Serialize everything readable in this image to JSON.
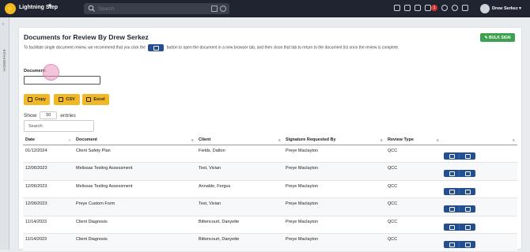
{
  "header": {
    "brand": "Lightning Step",
    "logo_glyph": "⚡",
    "search_placeholder": "Search",
    "notification_count": "1",
    "user_name": "Drew Serkez"
  },
  "sidebar": {
    "vertical_label": "HOMEPAGE"
  },
  "page": {
    "title": "Documents for Review By Drew Serkez",
    "bulk_sign_label": "BULK SIGN",
    "hint_before": "To facilitate single document review, we recommend that you click the",
    "hint_after": "button to open the document in a new browser tab, and then close that tab to return to the document list once the review is complete."
  },
  "filters": {
    "document_label": "Document:",
    "document_value": ""
  },
  "exports": [
    "Copy",
    "CSV",
    "Excel"
  ],
  "table_controls": {
    "show_label": "Show",
    "page_size": "50",
    "entries_label": "entries",
    "search_label": "Search:"
  },
  "table": {
    "columns": [
      "Date",
      "Document",
      "Client",
      "Signature Requested By",
      "Review Type",
      ""
    ],
    "rows": [
      [
        "01/12/2024",
        "Client Safety Plan",
        "Fields, Dalton",
        "Preye Maclayton",
        "QCC"
      ],
      [
        "12/06/2023",
        "Melissas Testing Assessment",
        "Test, Vivian",
        "Preye Maclayton",
        "QCC"
      ],
      [
        "12/06/2023",
        "Melissas Testing Assessment",
        "Annable, Fergus",
        "Preye Maclayton",
        "QCC"
      ],
      [
        "12/06/2023",
        "Preye Custom Form",
        "Test, Vivian",
        "Preye Maclayton",
        "QCC"
      ],
      [
        "11/14/2023",
        "Client Diagnosis",
        "Bittencourt, Danyette",
        "Preye Maclayton",
        "QCC"
      ],
      [
        "11/14/2023",
        "Client Diagnosis",
        "Bittencourt, Danyette",
        "Preye Maclayton",
        "QCC"
      ]
    ]
  },
  "colors": {
    "topbar": "#1f2430",
    "accent_yellow": "#f2b824",
    "action_blue": "#234e8f",
    "bulk_green": "#3fa04f",
    "badge_red": "#d9342b"
  }
}
